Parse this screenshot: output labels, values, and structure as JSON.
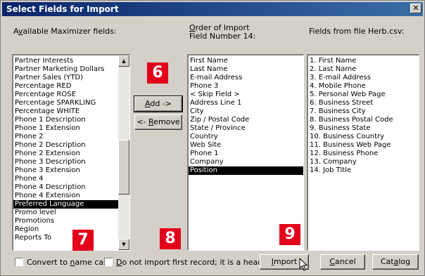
{
  "window": {
    "title": "Select Fields for Import",
    "close_glyph": "✕"
  },
  "labels": {
    "available_prefix": "A",
    "available_u": "v",
    "available_rest": "ailable Maximizer fields:",
    "order_line1_u": "O",
    "order_line1_rest": "rder of Import",
    "order_line2": "Field Number 14:",
    "fields_from_file": "Fields from file Herb.csv:"
  },
  "available_fields": [
    "Partner Interests",
    "Partner Marketing Dollars",
    "Partner Sales (YTD)",
    "Percentage RED",
    "Percentage ROSE",
    "Percentage SPARKLING",
    "Percentage WHITE",
    "Phone 1 Description",
    "Phone 1 Extension",
    "Phone 2",
    "Phone 2 Description",
    "Phone 2 Extension",
    "Phone 3 Description",
    "Phone 3 Extension",
    "Phone 4",
    "Phone 4 Description",
    "Phone 4 Extension",
    "Preferred Language",
    "Promo level",
    "Promotions",
    "Region",
    "Reports To"
  ],
  "available_selected": "Preferred Language",
  "import_order": [
    "First Name",
    "Last Name",
    "E-mail Address",
    "Phone 3",
    "< Skip Field >",
    "Address Line 1",
    "City",
    "Zip / Postal Code",
    "State / Province",
    "Country",
    "Web Site",
    "Phone 1",
    "Company",
    "Position"
  ],
  "import_selected": "Position",
  "file_fields": [
    "1. First Name",
    "2. Last Name",
    "3. E-mail Address",
    "4. Mobile Phone",
    "5. Personal Web Page",
    "6. Business Street",
    "7. Business City",
    "8. Business Postal Code",
    "9. Business State",
    "10. Business Country",
    "11. Business Web Page",
    "12. Business Phone",
    "13. Company",
    "14. Job Title"
  ],
  "buttons": {
    "add_u": "A",
    "add_rest": "dd ->",
    "remove_prefix": "<- ",
    "remove_u": "R",
    "remove_rest": "emove",
    "import_u": "I",
    "import_rest": "mport",
    "cancel_u": "C",
    "cancel_rest": "ancel",
    "catalog_prefix": "Cat",
    "catalog_u": "a",
    "catalog_rest": "log"
  },
  "checkboxes": {
    "convert_prefix": "Convert to ",
    "convert_u": "n",
    "convert_rest": "ame case",
    "no_header_u": "D",
    "no_header_rest": "o not import first record; it is a header"
  },
  "badges": {
    "b6": "6",
    "b7": "7",
    "b8": "8",
    "b9": "9"
  },
  "colors": {
    "badge": "#e3001b",
    "titlebar": "#0a246a",
    "face": "#d4d0c8"
  }
}
